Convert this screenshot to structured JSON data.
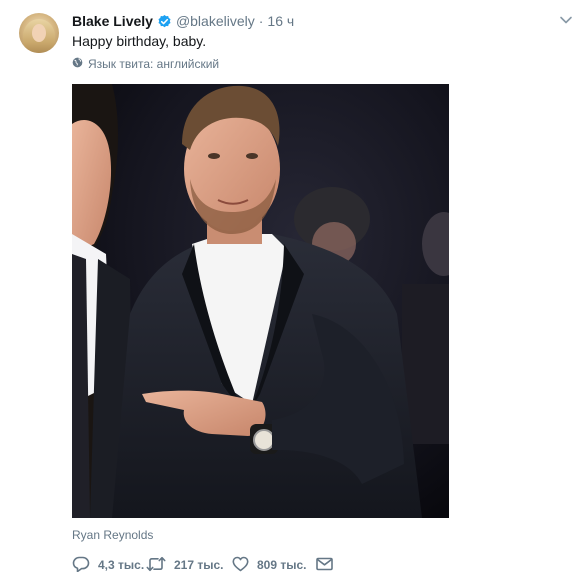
{
  "tweet": {
    "author_name": "Blake Lively",
    "handle": "@blakelively",
    "separator": "·",
    "time": "16 ч",
    "text": "Happy birthday, baby.",
    "language_note": "Язык твита: английский",
    "photo_caption": "Ryan Reynolds",
    "actions": {
      "replies": "4,3 тыс.",
      "retweets": "217 тыс.",
      "likes": "809 тыс."
    }
  },
  "icons": {
    "verified": "verified-badge-icon",
    "more": "chevron-down-icon",
    "globe": "globe-icon",
    "reply": "reply-icon",
    "retweet": "retweet-icon",
    "like": "heart-icon",
    "message": "envelope-icon"
  },
  "colors": {
    "text": "#14171a",
    "secondary": "#657786",
    "verified_blue": "#1da1f2"
  }
}
